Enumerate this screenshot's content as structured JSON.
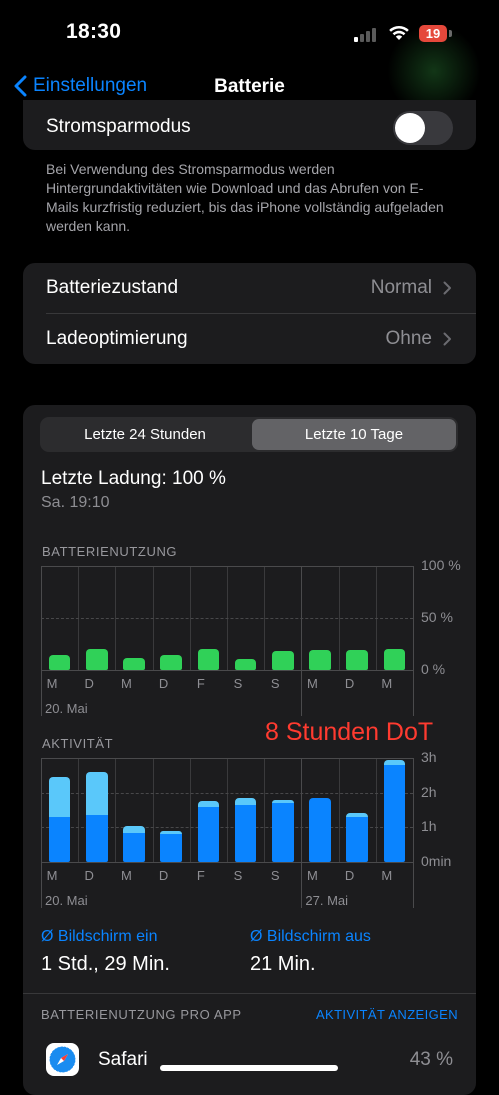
{
  "status_bar": {
    "time": "18:30",
    "battery_level": "19"
  },
  "nav": {
    "back_label": "Einstellungen",
    "title": "Batterie"
  },
  "low_power": {
    "label": "Stromsparmodus",
    "enabled": false,
    "footer": "Bei Verwendung des Stromsparmodus werden Hintergrundaktivitäten wie Download und das Abrufen von E-Mails kurzfristig reduziert, bis das iPhone vollständig aufgeladen werden kann."
  },
  "health_rows": [
    {
      "label": "Batteriezustand",
      "value": "Normal"
    },
    {
      "label": "Ladeoptimierung",
      "value": "Ohne"
    }
  ],
  "segmented": {
    "options": [
      "Letzte 24 Stunden",
      "Letzte 10 Tage"
    ],
    "selected_index": 1
  },
  "last_charge": {
    "label": "Letzte Ladung: 100 %",
    "time": "Sa. 19:10"
  },
  "usage_title": "BATTERIENUTZUNG",
  "activity_title": "AKTIVITÄT",
  "annotation": "8 Stunden DoT",
  "chart_data": [
    {
      "type": "bar",
      "title": "BATTERIENUTZUNG",
      "categories": [
        "M",
        "D",
        "M",
        "D",
        "F",
        "S",
        "S",
        "M",
        "D",
        "M"
      ],
      "date_labels": [
        {
          "index": 0,
          "text": "20. Mai"
        }
      ],
      "y_ticks": [
        "100 %",
        "50 %",
        "0 %"
      ],
      "ylim": [
        0,
        100
      ],
      "values": [
        14,
        20,
        12,
        14,
        20,
        11,
        18,
        19,
        19,
        20
      ],
      "color": "#30d158"
    },
    {
      "type": "bar",
      "title": "AKTIVITÄT",
      "categories": [
        "M",
        "D",
        "M",
        "D",
        "F",
        "S",
        "S",
        "M",
        "D",
        "M"
      ],
      "date_labels": [
        {
          "index": 0,
          "text": "20. Mai"
        },
        {
          "index": 7,
          "text": "27. Mai"
        }
      ],
      "y_ticks": [
        "3h",
        "2h",
        "1h",
        "0min"
      ],
      "ylim": [
        0,
        3
      ],
      "series": [
        {
          "name": "Bildschirm ein",
          "values": [
            1.3,
            1.35,
            0.85,
            0.8,
            1.6,
            1.65,
            1.7,
            1.85,
            1.3,
            2.8
          ],
          "color": "#0a84ff"
        },
        {
          "name": "Bildschirm aus",
          "values": [
            1.15,
            1.25,
            0.2,
            0.1,
            0.15,
            0.2,
            0.1,
            0.0,
            0.1,
            0.15
          ],
          "color": "#5ac8fa"
        }
      ]
    }
  ],
  "stats": [
    {
      "label": "Ø Bildschirm ein",
      "value": "1 Std., 29 Min."
    },
    {
      "label": "Ø Bildschirm aus",
      "value": "21 Min."
    }
  ],
  "per_app": {
    "title": "BATTERIENUTZUNG PRO APP",
    "action": "AKTIVITÄT ANZEIGEN"
  },
  "apps": [
    {
      "name": "Safari",
      "percent": "43 %"
    }
  ]
}
